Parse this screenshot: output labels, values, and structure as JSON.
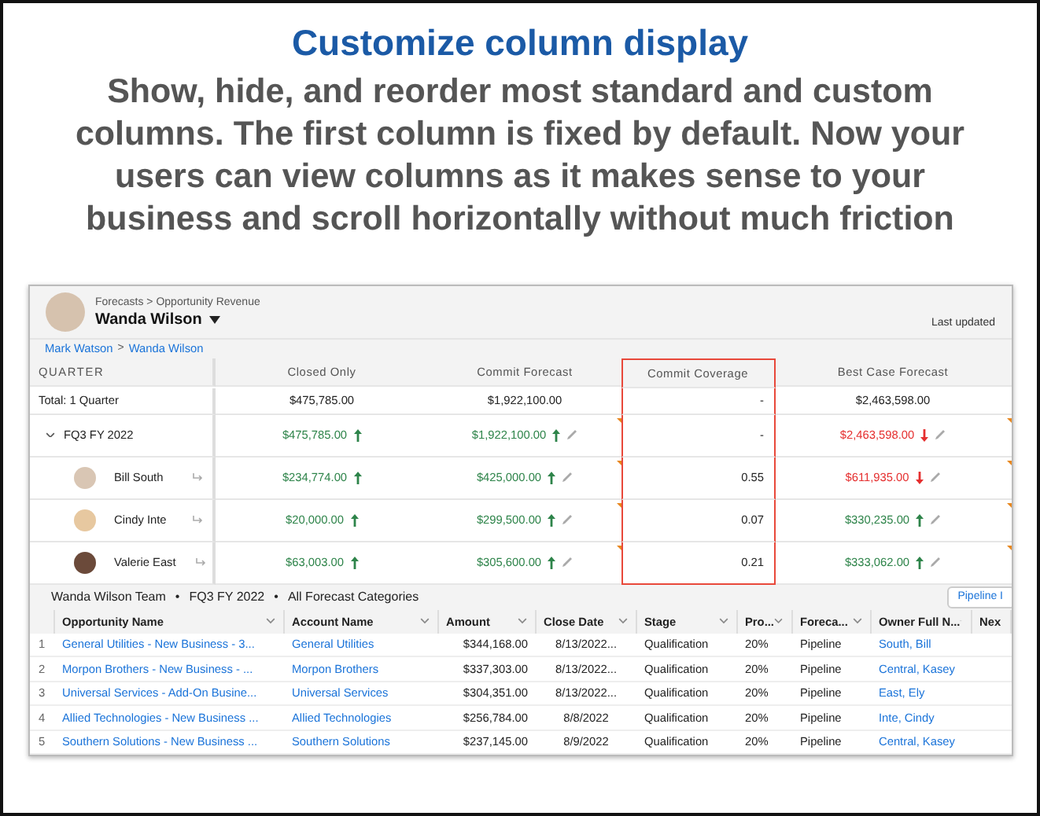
{
  "title": "Customize column display",
  "description": "Show, hide, and reorder most standard and custom columns. The first column is fixed by default.  Now your users can view columns as it makes sense to your business and scroll horizontally without much friction",
  "forecast": {
    "path": "Forecasts > Opportunity Revenue",
    "user_name": "Wanda Wilson",
    "last_updated": "Last updated",
    "trail": [
      "Mark Watson",
      "Wanda Wilson"
    ],
    "trail_separator": ">",
    "row_header_label": "QUARTER",
    "columns": [
      {
        "label": "Closed Only",
        "highlighted": false
      },
      {
        "label": "Commit Forecast",
        "highlighted": false
      },
      {
        "label": "Commit Coverage",
        "highlighted": true
      },
      {
        "label": "Best Case Forecast",
        "highlighted": false
      }
    ],
    "rows": [
      {
        "kind": "total",
        "name": "Total: 1 Quarter",
        "cells": [
          {
            "value": "$475,785.00",
            "rising": false,
            "falling": false,
            "editable": false
          },
          {
            "value": "$1,922,100.00",
            "rising": false,
            "falling": false,
            "editable": false
          },
          {
            "value": "-",
            "rising": false,
            "falling": false,
            "editable": false
          },
          {
            "value": "$2,463,598.00",
            "rising": false,
            "falling": false,
            "editable": false
          }
        ]
      },
      {
        "kind": "group",
        "name": "FQ3 FY 2022",
        "expanded": true,
        "cells": [
          {
            "value": "$475,785.00",
            "rising": true,
            "falling": false,
            "editable": false
          },
          {
            "value": "$1,922,100.00",
            "rising": true,
            "falling": false,
            "editable": true
          },
          {
            "value": "-",
            "rising": false,
            "falling": false,
            "editable": false
          },
          {
            "value": "$2,463,598.00",
            "rising": false,
            "falling": true,
            "editable": true
          }
        ]
      },
      {
        "kind": "person",
        "name": "Bill South",
        "cells": [
          {
            "value": "$234,774.00",
            "rising": true,
            "falling": false,
            "editable": false
          },
          {
            "value": "$425,000.00",
            "rising": true,
            "falling": false,
            "editable": true
          },
          {
            "value": "0.55",
            "rising": false,
            "falling": false,
            "editable": false
          },
          {
            "value": "$611,935.00",
            "rising": false,
            "falling": true,
            "editable": true
          }
        ]
      },
      {
        "kind": "person",
        "name": "Cindy Inte",
        "cells": [
          {
            "value": "$20,000.00",
            "rising": true,
            "falling": false,
            "editable": false
          },
          {
            "value": "$299,500.00",
            "rising": true,
            "falling": false,
            "editable": true
          },
          {
            "value": "0.07",
            "rising": false,
            "falling": false,
            "editable": false
          },
          {
            "value": "$330,235.00",
            "rising": true,
            "falling": false,
            "editable": true
          }
        ]
      },
      {
        "kind": "person",
        "name": "Valerie East",
        "cells": [
          {
            "value": "$63,003.00",
            "rising": true,
            "falling": false,
            "editable": false
          },
          {
            "value": "$305,600.00",
            "rising": true,
            "falling": false,
            "editable": true
          },
          {
            "value": "0.21",
            "rising": false,
            "falling": false,
            "editable": false
          },
          {
            "value": "$333,062.00",
            "rising": true,
            "falling": false,
            "editable": true
          }
        ]
      }
    ]
  },
  "opportunities": {
    "filters": [
      "Wanda Wilson Team",
      "FQ3 FY 2022",
      "All Forecast Categories"
    ],
    "filter_separator": "•",
    "button": "Pipeline I",
    "columns": [
      {
        "label": "Opportunity Name",
        "menu": true
      },
      {
        "label": "Account Name",
        "menu": true
      },
      {
        "label": "Amount",
        "menu": true
      },
      {
        "label": "Close Date",
        "menu": true
      },
      {
        "label": "Stage",
        "menu": true
      },
      {
        "label": "Pro...",
        "menu": true
      },
      {
        "label": "Foreca...",
        "menu": true
      },
      {
        "label": "Owner Full N...",
        "menu": true
      },
      {
        "label": "Nex",
        "menu": false
      }
    ],
    "rows": [
      {
        "index": "1",
        "cells": [
          "General Utilities - New Business - 3...",
          "General Utilities",
          "$344,168.00",
          "8/13/2022...",
          "Qualification",
          "20%",
          "Pipeline",
          "South, Bill"
        ]
      },
      {
        "index": "2",
        "cells": [
          "Morpon Brothers - New Business - ...",
          "Morpon Brothers",
          "$337,303.00",
          "8/13/2022...",
          "Qualification",
          "20%",
          "Pipeline",
          "Central, Kasey"
        ]
      },
      {
        "index": "3",
        "cells": [
          "Universal Services - Add-On Busine...",
          "Universal Services",
          "$304,351.00",
          "8/13/2022...",
          "Qualification",
          "20%",
          "Pipeline",
          "East, Ely"
        ]
      },
      {
        "index": "4",
        "cells": [
          "Allied Technologies - New Business ...",
          "Allied Technologies",
          "$256,784.00",
          "8/8/2022",
          "Qualification",
          "20%",
          "Pipeline",
          "Inte, Cindy"
        ]
      },
      {
        "index": "5",
        "cells": [
          "Southern Solutions - New Business ...",
          "Southern Solutions",
          "$237,145.00",
          "8/9/2022",
          "Qualification",
          "20%",
          "Pipeline",
          "Central, Kasey"
        ]
      }
    ]
  }
}
